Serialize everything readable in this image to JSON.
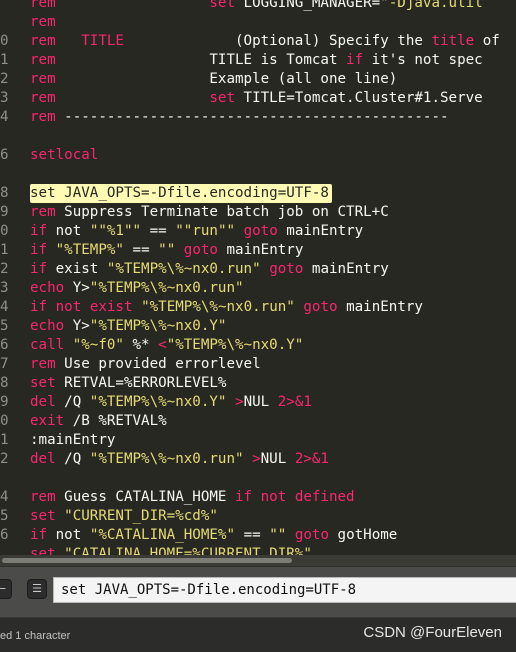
{
  "editor": {
    "lines": [
      {
        "no": "",
        "tokens": [
          [
            "rem",
            "kw"
          ],
          [
            "                  ",
            ""
          ],
          [
            "set",
            "kw"
          ],
          [
            " LOGGING_MANAGER=",
            "wh"
          ],
          [
            "\"-Djava.util",
            "str"
          ]
        ]
      },
      {
        "no": "",
        "tokens": [
          [
            "rem",
            "kw"
          ]
        ]
      },
      {
        "no": "0",
        "tokens": [
          [
            "rem",
            "kw"
          ],
          [
            "   ",
            ""
          ],
          [
            "TITLE",
            "kw"
          ],
          [
            "             (Optional) Specify the ",
            "wh"
          ],
          [
            "title",
            "kw"
          ],
          [
            " of",
            "wh"
          ]
        ]
      },
      {
        "no": "1",
        "tokens": [
          [
            "rem",
            "kw"
          ],
          [
            "                  TITLE is Tomcat ",
            "wh"
          ],
          [
            "if",
            "kw"
          ],
          [
            " it's not spec",
            "wh"
          ]
        ]
      },
      {
        "no": "2",
        "tokens": [
          [
            "rem",
            "kw"
          ],
          [
            "                  Example (all one line)",
            "wh"
          ]
        ]
      },
      {
        "no": "3",
        "tokens": [
          [
            "rem",
            "kw"
          ],
          [
            "                  ",
            ""
          ],
          [
            "set",
            "kw"
          ],
          [
            " TITLE=Tomcat.Cluster#1.Serve",
            "wh"
          ]
        ]
      },
      {
        "no": "4",
        "tokens": [
          [
            "rem",
            "kw"
          ],
          [
            " ---------------------------------------------",
            "wh"
          ]
        ]
      },
      {
        "no": "",
        "tokens": []
      },
      {
        "no": "6",
        "tokens": [
          [
            "setlocal",
            "kw"
          ]
        ]
      },
      {
        "no": "",
        "tokens": []
      },
      {
        "no": "8",
        "hl": true,
        "tokens": [
          [
            "set JAVA_OPTS=-Dfile.encoding=UTF-8",
            "wh"
          ]
        ]
      },
      {
        "no": "9",
        "tokens": [
          [
            "rem",
            "kw"
          ],
          [
            " Suppress Terminate batch job on CTRL+C",
            "wh"
          ]
        ]
      },
      {
        "no": "0",
        "tokens": [
          [
            "if",
            "kw"
          ],
          [
            " not ",
            "wh"
          ],
          [
            "\"\"%1\"\"",
            "str"
          ],
          [
            " == ",
            "wh"
          ],
          [
            "\"\"run\"\"",
            "str"
          ],
          [
            " ",
            ""
          ],
          [
            "goto",
            "kw"
          ],
          [
            " mainEntry",
            "wh"
          ]
        ]
      },
      {
        "no": "1",
        "tokens": [
          [
            "if",
            "kw"
          ],
          [
            " ",
            "wh"
          ],
          [
            "\"%TEMP%\"",
            "str"
          ],
          [
            " == ",
            "wh"
          ],
          [
            "\"\"",
            "str"
          ],
          [
            " ",
            ""
          ],
          [
            "goto",
            "kw"
          ],
          [
            " mainEntry",
            "wh"
          ]
        ]
      },
      {
        "no": "2",
        "tokens": [
          [
            "if",
            "kw"
          ],
          [
            " exist ",
            "wh"
          ],
          [
            "\"%TEMP%\\%~nx0.run\"",
            "str"
          ],
          [
            " ",
            ""
          ],
          [
            "goto",
            "kw"
          ],
          [
            " mainEntry",
            "wh"
          ]
        ]
      },
      {
        "no": "3",
        "tokens": [
          [
            "echo",
            "kw"
          ],
          [
            " Y>",
            "wh"
          ],
          [
            "\"%TEMP%\\%~nx0.run\"",
            "str"
          ]
        ]
      },
      {
        "no": "4",
        "tokens": [
          [
            "if",
            "kw"
          ],
          [
            " ",
            ""
          ],
          [
            "not",
            "kw"
          ],
          [
            " ",
            ""
          ],
          [
            "exist",
            "kw"
          ],
          [
            " ",
            "wh"
          ],
          [
            "\"%TEMP%\\%~nx0.run\"",
            "str"
          ],
          [
            " ",
            ""
          ],
          [
            "goto",
            "kw"
          ],
          [
            " mainEntry",
            "wh"
          ]
        ]
      },
      {
        "no": "5",
        "tokens": [
          [
            "echo",
            "kw"
          ],
          [
            " Y>",
            "wh"
          ],
          [
            "\"%TEMP%\\%~nx0.Y\"",
            "str"
          ]
        ]
      },
      {
        "no": "6",
        "tokens": [
          [
            "call",
            "kw"
          ],
          [
            " ",
            ""
          ],
          [
            "\"%~f0\"",
            "str"
          ],
          [
            " %* ",
            "wh"
          ],
          [
            "<",
            "kw"
          ],
          [
            "\"%TEMP%\\%~nx0.Y\"",
            "str"
          ]
        ]
      },
      {
        "no": "7",
        "tokens": [
          [
            "rem",
            "kw"
          ],
          [
            " Use provided errorlevel",
            "wh"
          ]
        ]
      },
      {
        "no": "8",
        "tokens": [
          [
            "set",
            "kw"
          ],
          [
            " RETVAL=%ERRORLEVEL%",
            "wh"
          ]
        ]
      },
      {
        "no": "9",
        "tokens": [
          [
            "del",
            "kw"
          ],
          [
            " /Q ",
            "wh"
          ],
          [
            "\"%TEMP%\\%~nx0.Y\"",
            "str"
          ],
          [
            " ",
            ""
          ],
          [
            ">",
            "kw"
          ],
          [
            "NUL ",
            "wh"
          ],
          [
            "2>&1",
            "kw"
          ]
        ]
      },
      {
        "no": "0",
        "tokens": [
          [
            "exit",
            "kw"
          ],
          [
            " /B %RETVAL%",
            "wh"
          ]
        ]
      },
      {
        "no": "1",
        "tokens": [
          [
            ":mainEntry",
            "wh"
          ]
        ]
      },
      {
        "no": "2",
        "tokens": [
          [
            "del",
            "kw"
          ],
          [
            " /Q ",
            "wh"
          ],
          [
            "\"%TEMP%\\%~nx0.run\"",
            "str"
          ],
          [
            " ",
            ""
          ],
          [
            ">",
            "kw"
          ],
          [
            "NUL ",
            "wh"
          ],
          [
            "2>&1",
            "kw"
          ]
        ]
      },
      {
        "no": "",
        "tokens": []
      },
      {
        "no": "4",
        "tokens": [
          [
            "rem",
            "kw"
          ],
          [
            " Guess CATALINA_HOME ",
            "wh"
          ],
          [
            "if",
            "kw"
          ],
          [
            " ",
            ""
          ],
          [
            "not",
            "kw"
          ],
          [
            " ",
            ""
          ],
          [
            "defined",
            "kw"
          ]
        ]
      },
      {
        "no": "5",
        "tokens": [
          [
            "set",
            "kw"
          ],
          [
            " ",
            ""
          ],
          [
            "\"CURRENT_DIR=%cd%\"",
            "str"
          ]
        ]
      },
      {
        "no": "6",
        "tokens": [
          [
            "if",
            "kw"
          ],
          [
            " not ",
            "wh"
          ],
          [
            "\"%CATALINA_HOME%\"",
            "str"
          ],
          [
            " == ",
            "wh"
          ],
          [
            "\"\"",
            "str"
          ],
          [
            " ",
            ""
          ],
          [
            "goto",
            "kw"
          ],
          [
            " gotHome",
            "wh"
          ]
        ]
      },
      {
        "no": "",
        "tokens": [
          [
            "set",
            "kw"
          ],
          [
            " ",
            ""
          ],
          [
            "\"CATALINA_HOME=%CURRENT_DIR%\"",
            "str"
          ]
        ]
      }
    ]
  },
  "find_panel": {
    "input_value": "set JAVA_OPTS=-Dfile.encoding=UTF-8"
  },
  "status_bar": {
    "text": "ed 1 character",
    "watermark": "CSDN @FourEleven"
  },
  "colors": {
    "background": "#272822",
    "keyword": "#f92672",
    "string": "#e6db74",
    "text": "#f8f8f2",
    "selection": "#fffbb5"
  }
}
